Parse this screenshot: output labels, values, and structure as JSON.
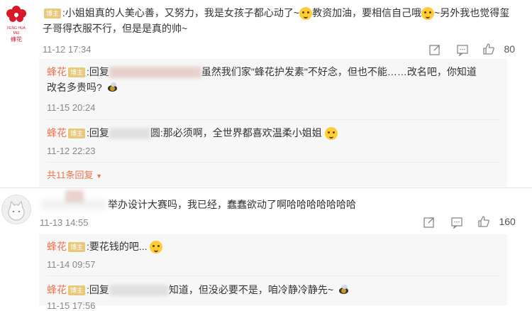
{
  "top_comment": {
    "logo_text_top": "FENG HUA MEI",
    "logo_text_bottom": "蜂花",
    "text_part1": ":小姐姐真的人美心善，又努力，我是女孩子都心动了~",
    "text_part2": "教资加油，要相信自己哦",
    "text_part3": "~另外我也觉得玺子哥得衣服不行，但是是真的帅~",
    "time": "11-12 17:34",
    "like_count": "80"
  },
  "badge_label": "博主",
  "replies_1": [
    {
      "nick": "蜂花",
      "prefix": ":回复",
      "text": "虽然我们家\"蜂花护发素\"不好念，但也不能……改名吧，你知道",
      "text2": "改名多贵吗?",
      "time": "11-15 20:24"
    },
    {
      "nick": "蜂花",
      "prefix": ":回复",
      "text": "圆:那必须啊，全世界都喜欢温柔小姐姐",
      "time": "11-12 22:23"
    }
  ],
  "more_replies": "共11条回复",
  "second_comment": {
    "text": "举办设计大赛吗，我已经，蠢蠢欲动了啊哈哈哈哈哈哈哈",
    "time": "11-13 14:55",
    "like_count": "160"
  },
  "replies_2": [
    {
      "nick": "蜂花",
      "text": ":要花钱的吧...",
      "time": "11-14 09:57"
    },
    {
      "nick": "蜂花",
      "prefix": ":回复",
      "text": "知道，但没必要不是，咱冷静冷静先~",
      "time": "11-15 17:56"
    }
  ],
  "icons": [
    "forward-icon",
    "comment-icon",
    "like-icon"
  ]
}
